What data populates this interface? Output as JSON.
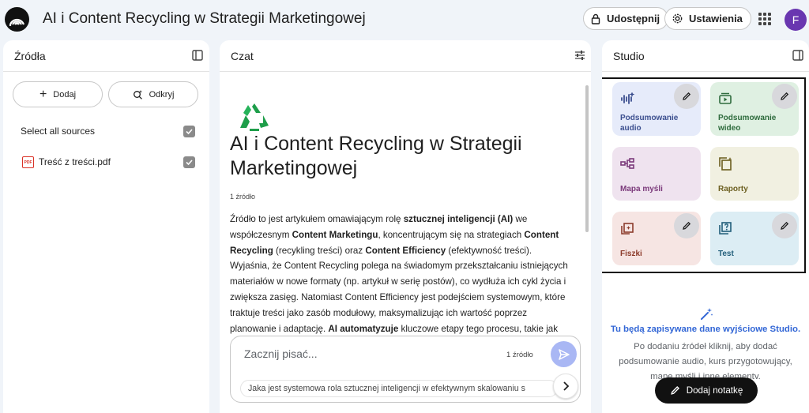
{
  "header": {
    "title": "AI i Content Recycling w Strategii Marketingowej",
    "share_label": "Udostępnij",
    "settings_label": "Ustawienia",
    "avatar_initial": "F",
    "icons": {
      "logo": "notebooklm-logo",
      "share": "lock-icon",
      "settings": "gear-icon",
      "apps": "apps-grid-icon"
    }
  },
  "sources": {
    "title": "Źródła",
    "add_label": "Dodaj",
    "discover_label": "Odkryj",
    "select_all_label": "Select all sources",
    "items": [
      {
        "name": "Treść z treści.pdf",
        "type": "PDF",
        "checked": true
      }
    ]
  },
  "chat": {
    "title": "Czat",
    "heading": "AI i Content Recycling w Strategii Marketingowej",
    "source_count": "1 źródło",
    "summary_parts": [
      {
        "text": "Źródło to jest artykułem omawiającym rolę ",
        "bold": false
      },
      {
        "text": "sztucznej inteligencji (AI)",
        "bold": true
      },
      {
        "text": " we współczesnym ",
        "bold": false
      },
      {
        "text": "Content Marketingu",
        "bold": true
      },
      {
        "text": ", koncentrującym się na strategiach ",
        "bold": false
      },
      {
        "text": "Content Recycling",
        "bold": true
      },
      {
        "text": " (recykling treści) oraz ",
        "bold": false
      },
      {
        "text": "Content Efficiency",
        "bold": true
      },
      {
        "text": " (efektywność treści). Wyjaśnia, że Content Recycling polega na świadomym przekształcaniu istniejących materiałów w nowe formaty (np. artykuł w serię postów), co wydłuża ich cykl życia i zwiększa zasięg. Natomiast Content Efficiency jest podejściem systemowym, które traktuje treści jako zasób modułowy, maksymalizując ich wartość poprzez planowanie i adaptację. ",
        "bold": false
      },
      {
        "text": "AI automatyzuje",
        "bold": true
      },
      {
        "text": " kluczowe etapy tego procesu, takie jak",
        "bold": false
      }
    ],
    "input_placeholder": "Zacznij pisać...",
    "input_source_count": "1 źródło",
    "suggestion": "Jaka jest systemowa rola sztucznej inteligencji w efektywnym skalowaniu s"
  },
  "studio": {
    "title": "Studio",
    "cards": [
      {
        "label": "Podsumowanie audio",
        "icon": "audio-waveform-icon",
        "bg": "#e6ebfa",
        "fg": "#3c4f8f",
        "editable": true
      },
      {
        "label": "Podsumowanie wideo",
        "icon": "video-play-icon",
        "bg": "#dff0e2",
        "fg": "#2e6b3d",
        "editable": true
      },
      {
        "label": "Mapa myśli",
        "icon": "mind-map-icon",
        "bg": "#efe3ef",
        "fg": "#7b3a7b",
        "editable": false
      },
      {
        "label": "Raporty",
        "icon": "report-icon",
        "bg": "#f1f0e1",
        "fg": "#6b5e1f",
        "editable": false
      },
      {
        "label": "Fiszki",
        "icon": "flashcards-icon",
        "bg": "#f6e5e3",
        "fg": "#8c3b2b",
        "editable": true
      },
      {
        "label": "Test",
        "icon": "quiz-icon",
        "bg": "#dcedf4",
        "fg": "#215e7a",
        "editable": true
      }
    ],
    "empty_title": "Tu będą zapisywane dane wyjściowe Studio.",
    "empty_desc": "Po dodaniu źródeł kliknij, aby dodać podsumowanie audio, kurs przygotowujący, mapę myśli i inne elementy.",
    "add_note_label": "Dodaj notatkę"
  }
}
